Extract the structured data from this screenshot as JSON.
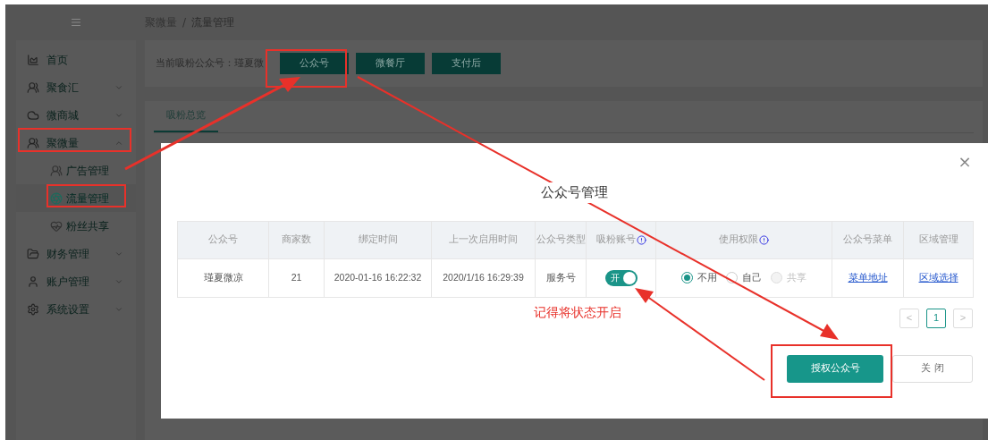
{
  "sidebar": {
    "items": [
      {
        "label": "首页"
      },
      {
        "label": "聚食汇",
        "expanded": false
      },
      {
        "label": "微商城",
        "expanded": false
      },
      {
        "label": "聚微量",
        "expanded": true,
        "children": [
          {
            "label": "广告管理",
            "selected": false
          },
          {
            "label": "流量管理",
            "selected": true
          },
          {
            "label": "粉丝共享",
            "selected": false
          }
        ]
      },
      {
        "label": "财务管理",
        "expanded": false
      },
      {
        "label": "账户管理",
        "expanded": false
      },
      {
        "label": "系统设置",
        "expanded": false
      }
    ]
  },
  "breadcrumb": {
    "items": [
      "聚微量",
      "流量管理"
    ],
    "separator": "/"
  },
  "toolbar": {
    "label": "当前吸粉公众号：瑾夏微",
    "buttons": [
      "公众号",
      "微餐厅",
      "支付后"
    ]
  },
  "tabs": [
    {
      "label": "吸粉总览",
      "selected": true
    }
  ],
  "modal": {
    "title": "公众号管理",
    "close": "×",
    "columns": [
      {
        "label": "公众号",
        "info": false
      },
      {
        "label": "商家数",
        "info": false
      },
      {
        "label": "绑定时间",
        "info": false
      },
      {
        "label": "上一次启用时间",
        "info": false
      },
      {
        "label": "公众号类型",
        "info": false
      },
      {
        "label": "吸粉账号",
        "info": true
      },
      {
        "label": "使用权限",
        "info": true
      },
      {
        "label": "公众号菜单",
        "info": false
      },
      {
        "label": "区域管理",
        "info": false
      }
    ],
    "rows": [
      [
        {
          "kind": "text",
          "text": "瑾夏微凉"
        },
        {
          "kind": "text",
          "text": "21"
        },
        {
          "kind": "text",
          "text": "2020-01-16 16:22:32"
        },
        {
          "kind": "text",
          "text": "2020/1/16 16:29:39"
        },
        {
          "kind": "text",
          "text": "服务号"
        },
        {
          "kind": "toggle",
          "on": true,
          "text": "开"
        },
        {
          "kind": "radios",
          "options": [
            {
              "label": "不用",
              "selected": true,
              "disabled": false
            },
            {
              "label": "自己",
              "selected": false,
              "disabled": false
            },
            {
              "label": "共享",
              "selected": false,
              "disabled": true
            }
          ]
        },
        {
          "kind": "link",
          "text": "菜单地址"
        },
        {
          "kind": "link",
          "text": "区域选择"
        }
      ]
    ],
    "pagination": {
      "prev": "<",
      "pages": [
        {
          "label": "1",
          "selected": true
        }
      ],
      "next": ">"
    },
    "buttons": [
      {
        "label": "授权公众号",
        "kind": "primary"
      },
      {
        "label": "关 闭",
        "kind": "secondary"
      }
    ]
  },
  "annotation": {
    "note": "记得将状态开启"
  }
}
